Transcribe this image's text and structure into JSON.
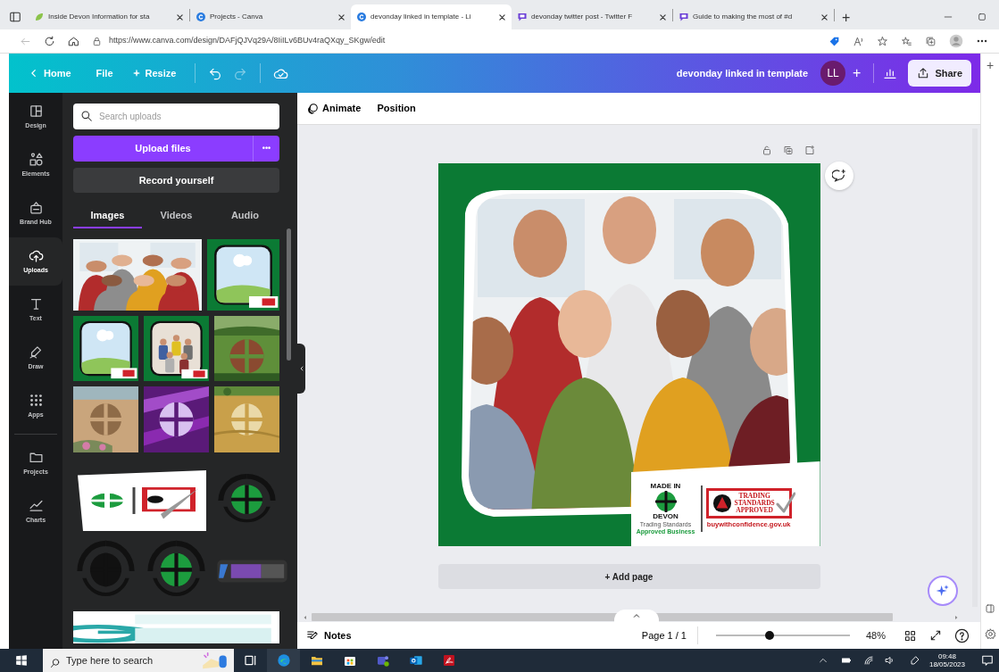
{
  "browser": {
    "tabs": [
      {
        "title": "Inside Devon Information for sta",
        "selected": false
      },
      {
        "title": "Projects - Canva",
        "selected": false
      },
      {
        "title": "devonday linked in template - Li",
        "selected": true
      },
      {
        "title": "devonday twitter post - Twitter F",
        "selected": false
      },
      {
        "title": "Guide to making the most of #d",
        "selected": false
      }
    ],
    "new_tab": "+",
    "url": "https://www.canva.com/design/DAFjQJVq29A/8IiILv6BUv4raQXqy_SKgw/edit"
  },
  "header": {
    "menu": [
      "Home",
      "File",
      "Resize"
    ],
    "design_title": "devonday linked in template",
    "avatar": "LL",
    "add": "+",
    "share": "Share"
  },
  "edge_sidebar": {
    "add": "+"
  },
  "rail": [
    {
      "label": "Design",
      "selected": false
    },
    {
      "label": "Elements",
      "selected": false
    },
    {
      "label": "Brand Hub",
      "selected": false
    },
    {
      "label": "Uploads",
      "selected": true
    },
    {
      "label": "Text",
      "selected": false
    },
    {
      "label": "Draw",
      "selected": false
    },
    {
      "label": "Apps",
      "selected": false
    },
    {
      "label": "Projects",
      "selected": false
    },
    {
      "label": "Charts",
      "selected": false
    }
  ],
  "panel": {
    "search": {
      "placeholder": "Search uploads"
    },
    "upload_button": "Upload files",
    "more_button": "•••",
    "record_button": "Record yourself",
    "tabs": [
      {
        "label": "Images",
        "selected": true
      },
      {
        "label": "Videos",
        "selected": false
      },
      {
        "label": "Audio",
        "selected": false
      }
    ]
  },
  "toolbar": [
    "Animate",
    "Position"
  ],
  "design": {
    "badge_top": "MADE IN",
    "badge_bottom": "DEVON",
    "badge_caption": [
      "Trading Standards",
      "Approved Business"
    ],
    "stamp": [
      "TRADING",
      "STANDARDS",
      "APPROVED"
    ],
    "stamp_url": "buywithconfidence.gov.uk"
  },
  "add_page": "+ Add page",
  "footer": {
    "notes": "Notes",
    "page": "Page 1 / 1",
    "zoom": {
      "level": 0.4,
      "reading": "48%"
    }
  },
  "taskbar": {
    "search": {
      "placeholder": "Type here to search"
    },
    "time": "09:48",
    "date": "18/05/2023"
  }
}
